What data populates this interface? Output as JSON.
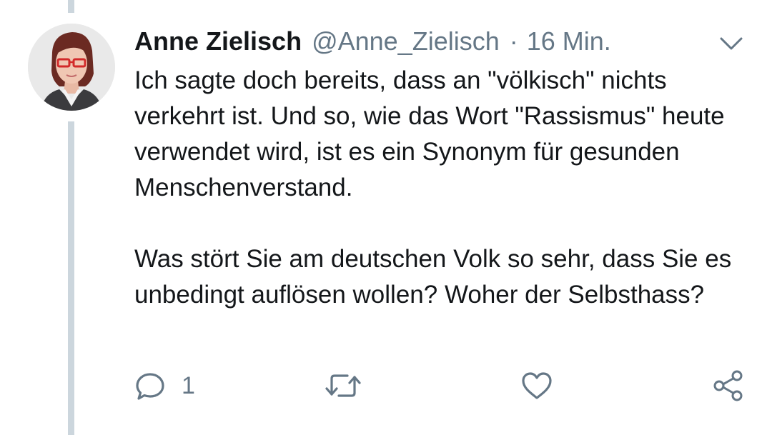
{
  "tweet": {
    "author_name": "Anne Zielisch",
    "author_handle": "@Anne_Zielisch",
    "separator": "·",
    "time": "16 Min.",
    "paragraphs": [
      "Ich sagte doch bereits, dass an \"völkisch\" nichts verkehrt ist. Und so, wie das Wort \"Rassismus\" heute verwendet wird, ist es ein Synonym für gesunden Menschenverstand.",
      "Was stört Sie am deutschen Volk so sehr, dass Sie es unbedingt auflösen wollen? Woher der Selbsthass?"
    ]
  },
  "actions": {
    "reply_count": "1",
    "icons": [
      "reply-icon",
      "retweet-icon",
      "like-icon",
      "share-icon"
    ],
    "menu_icon": "chevron-down-icon"
  },
  "colors": {
    "text": "#14171a",
    "secondary": "#657786",
    "thread_line": "#ccd6dd"
  }
}
